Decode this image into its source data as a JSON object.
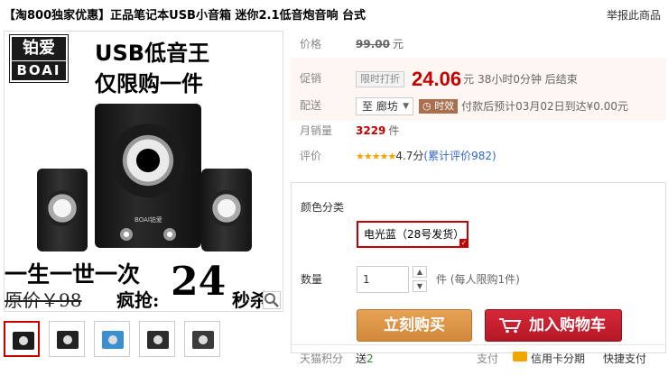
{
  "title": "【淘800独家优惠】正品笔记本USB小音箱 迷你2.1低音炮音响 台式",
  "report_link": "举报此商品",
  "image": {
    "brand_cn": "铂爱",
    "brand_en": "BOAI",
    "headline1": "USB低音王",
    "headline2": "仅限购一件",
    "speaker_tag": "BOAI铂爱",
    "slogan": "一生一世一次",
    "orig_price": "原价￥98",
    "crazy": "疯抢:",
    "big_price": "24",
    "price_suffix": "秒杀"
  },
  "price": {
    "label": "价格",
    "value": "99.00",
    "unit": "元"
  },
  "promo": {
    "label": "促销",
    "tag": "限时打折",
    "value": "24.06",
    "unit": "元",
    "countdown": "38小时0分钟 后结束"
  },
  "delivery": {
    "label": "配送",
    "location": "至 廊坊",
    "ship_tag": "时效",
    "ship_text": "付款后预计03月02日到达¥0.00元"
  },
  "monthly": {
    "label": "月销量",
    "value": "3229",
    "unit": "件"
  },
  "rating": {
    "label": "评价",
    "stars": "★★★★★",
    "score": "4.7分",
    "link": "(累计评价982)"
  },
  "options": {
    "color_label": "颜色分类",
    "color_value": "电光蓝（28号发货）",
    "qty_label": "数量",
    "qty_value": "1",
    "qty_unit": "件 (每人限购1件)",
    "buy_label": "立刻购买",
    "cart_label": "加入购物车"
  },
  "footer": {
    "points_label": "天猫积分",
    "points_prefix": "送",
    "points_value": "2",
    "pay_label": "支付",
    "card_label": "信用卡分期",
    "fast_label": "快捷支付"
  },
  "thumbnails": [
    {
      "color": "#1c1c1c",
      "active": true
    },
    {
      "color": "#222222",
      "active": false
    },
    {
      "color": "#3a8fd1",
      "active": false
    },
    {
      "color": "#2c2c2c",
      "active": false
    },
    {
      "color": "#3b3b3b",
      "active": false
    }
  ],
  "colors": {
    "price_red": "#c40000",
    "buy_orange": "#e7a255",
    "cart_red": "#d6283a"
  }
}
